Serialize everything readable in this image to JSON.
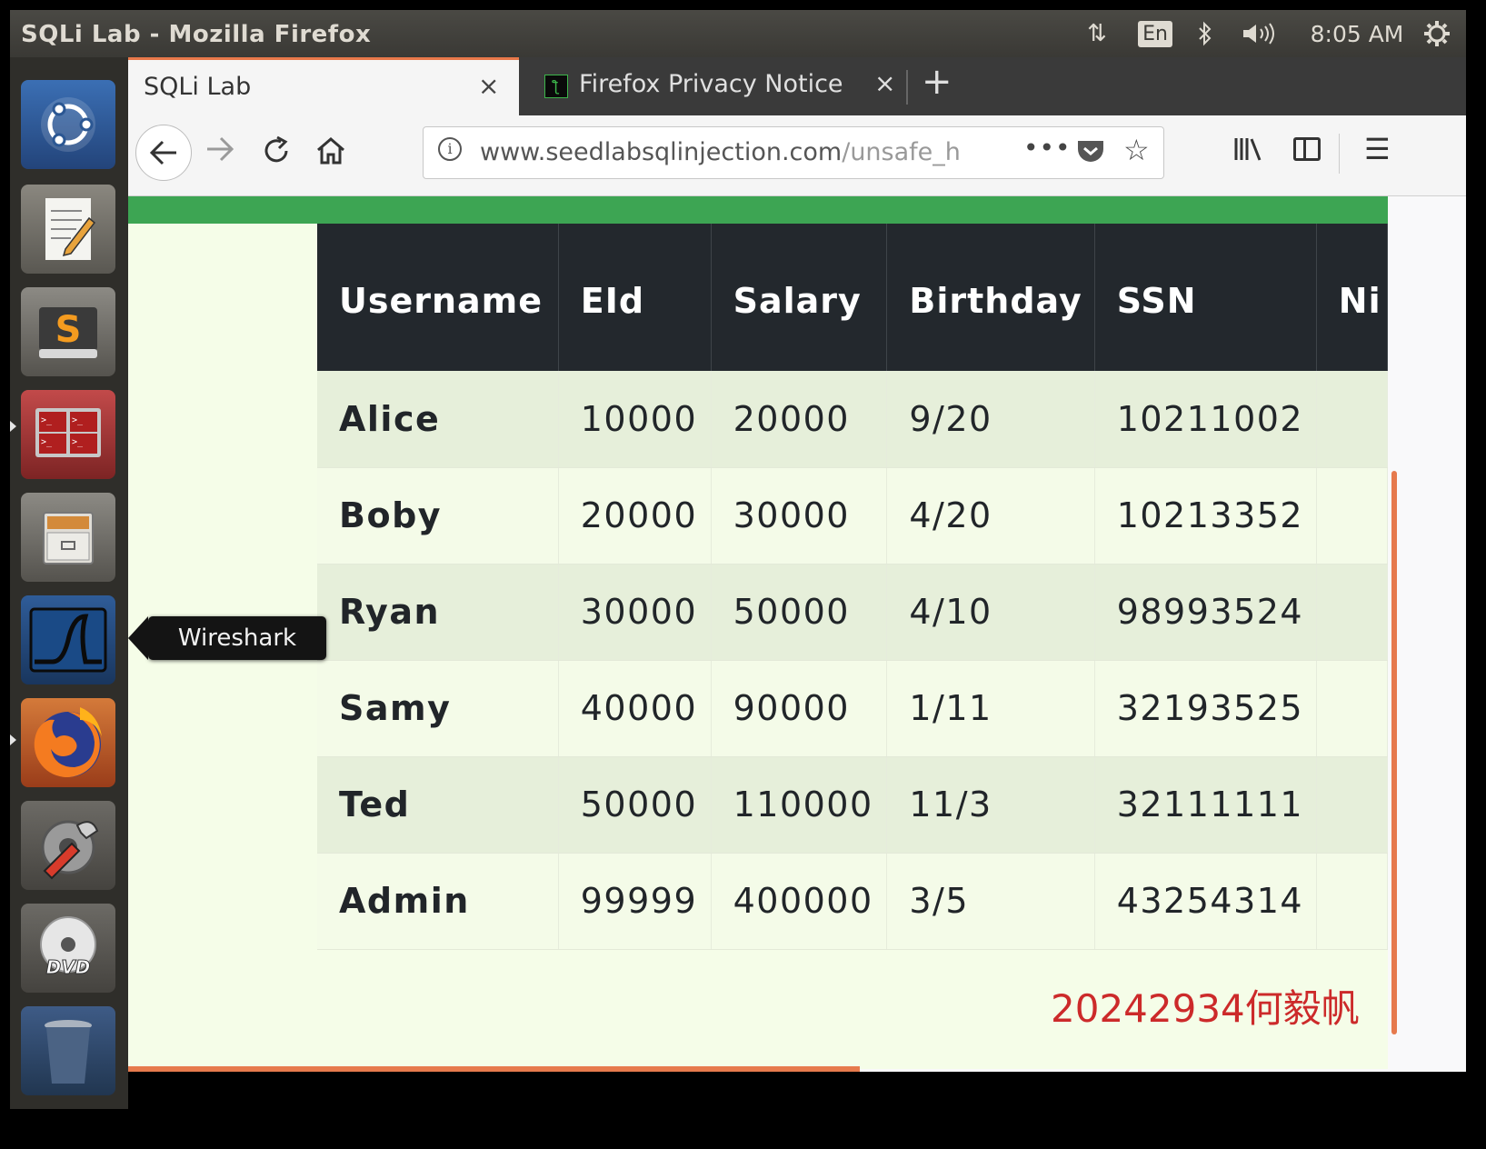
{
  "top_panel": {
    "window_title": "SQLi Lab - Mozilla Firefox",
    "keyboard_lang": "En",
    "clock": "8:05 AM"
  },
  "launcher": {
    "items": [
      "ubuntu-icon",
      "text-editor-icon",
      "sublime-text-icon",
      "terminal-icon",
      "files-icon",
      "wireshark-icon",
      "firefox-icon",
      "settings-icon",
      "dvd-icon",
      "trash-icon"
    ],
    "tooltip": "Wireshark"
  },
  "browser": {
    "tabs": [
      {
        "label": "SQLi Lab",
        "close": "×"
      },
      {
        "label": "Firefox Privacy Notice —",
        "close": "×"
      }
    ],
    "new_tab": "+",
    "url_main": "www.seedlabsqlinjection.com",
    "url_rest": "/unsafe_h",
    "url_more": "•••"
  },
  "table": {
    "headers": [
      "Username",
      "EId",
      "Salary",
      "Birthday",
      "SSN",
      "Ni"
    ],
    "rows": [
      [
        "Alice",
        "10000",
        "20000",
        "9/20",
        "10211002",
        ""
      ],
      [
        "Boby",
        "20000",
        "30000",
        "4/20",
        "10213352",
        ""
      ],
      [
        "Ryan",
        "30000",
        "50000",
        "4/10",
        "98993524",
        ""
      ],
      [
        "Samy",
        "40000",
        "90000",
        "1/11",
        "32193525",
        ""
      ],
      [
        "Ted",
        "50000",
        "110000",
        "11/3",
        "32111111",
        ""
      ],
      [
        "Admin",
        "99999",
        "400000",
        "3/5",
        "43254314",
        ""
      ]
    ]
  },
  "watermark": "20242934何毅帆",
  "colors": {
    "green_bar": "#3da553",
    "table_header": "#23282d",
    "accent_orange": "#e8784a",
    "watermark": "#cc2a2a"
  }
}
